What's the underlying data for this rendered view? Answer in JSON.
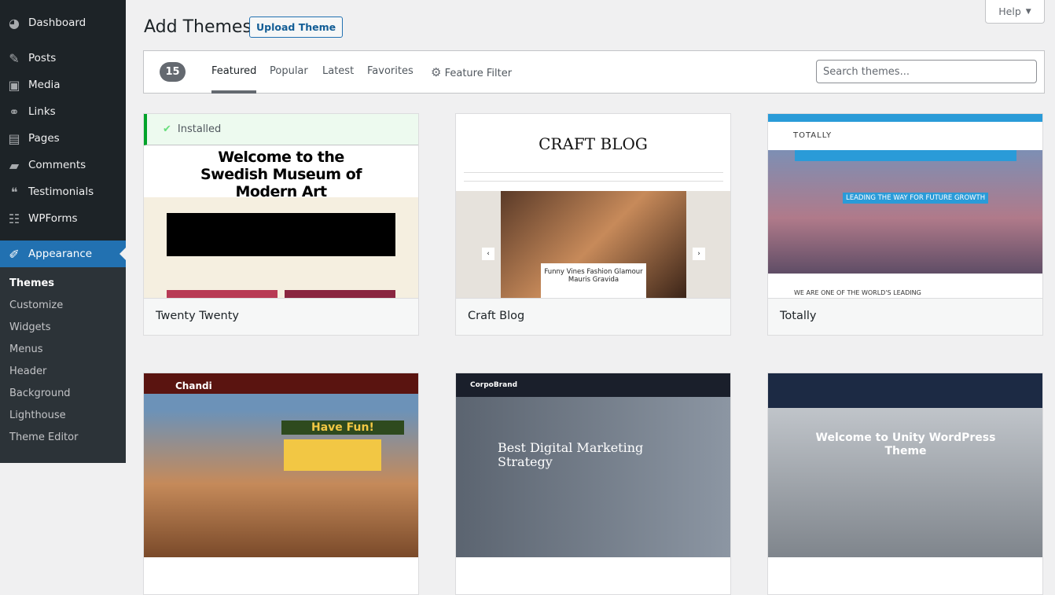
{
  "sidebar": {
    "items": [
      {
        "label": "Dashboard",
        "icon": "dashboard-icon",
        "glyph": "◕"
      },
      {
        "label": "Posts",
        "icon": "pin-icon",
        "glyph": "✎"
      },
      {
        "label": "Media",
        "icon": "media-icon",
        "glyph": "▣"
      },
      {
        "label": "Links",
        "icon": "link-icon",
        "glyph": "⚭"
      },
      {
        "label": "Pages",
        "icon": "pages-icon",
        "glyph": "▤"
      },
      {
        "label": "Comments",
        "icon": "comment-icon",
        "glyph": "▰"
      },
      {
        "label": "Testimonials",
        "icon": "quote-icon",
        "glyph": "❝"
      },
      {
        "label": "WPForms",
        "icon": "forms-icon",
        "glyph": "☷"
      },
      {
        "label": "Appearance",
        "icon": "brush-icon",
        "glyph": "✐"
      }
    ],
    "submenu": [
      "Themes",
      "Customize",
      "Widgets",
      "Menus",
      "Header",
      "Background",
      "Lighthouse",
      "Theme Editor"
    ]
  },
  "header": {
    "title": "Add Themes",
    "upload_label": "Upload Theme",
    "help_label": "Help"
  },
  "filter": {
    "count": "15",
    "tabs": [
      "Featured",
      "Popular",
      "Latest",
      "Favorites"
    ],
    "feature_filter": "Feature Filter",
    "search_placeholder": "Search themes..."
  },
  "themes": [
    {
      "name": "Twenty Twenty",
      "installed": "Installed",
      "headline": "Welcome to the Swedish Museum of Modern Art"
    },
    {
      "name": "Craft Blog",
      "headline": "CRAFT BLOG",
      "caption": "Funny Vines Fashion Glamour Mauris Gravida"
    },
    {
      "name": "Totally",
      "headline": "LEADING THE WAY FOR FUTURE GROWTH",
      "sub": "WE ARE ONE OF THE WORLD'S LEADING",
      "logo": "TOTALLY"
    },
    {
      "name": "",
      "headline": "Have Fun!",
      "logo": "Chandi"
    },
    {
      "name": "",
      "headline": "Best Digital Marketing Strategy",
      "logo": "CorpoBrand"
    },
    {
      "name": "",
      "headline": "Welcome to Unity WordPress Theme"
    }
  ],
  "colors": {
    "sidebar": "#1d2327",
    "accent": "#2271b1",
    "installed": "#00a32a"
  }
}
